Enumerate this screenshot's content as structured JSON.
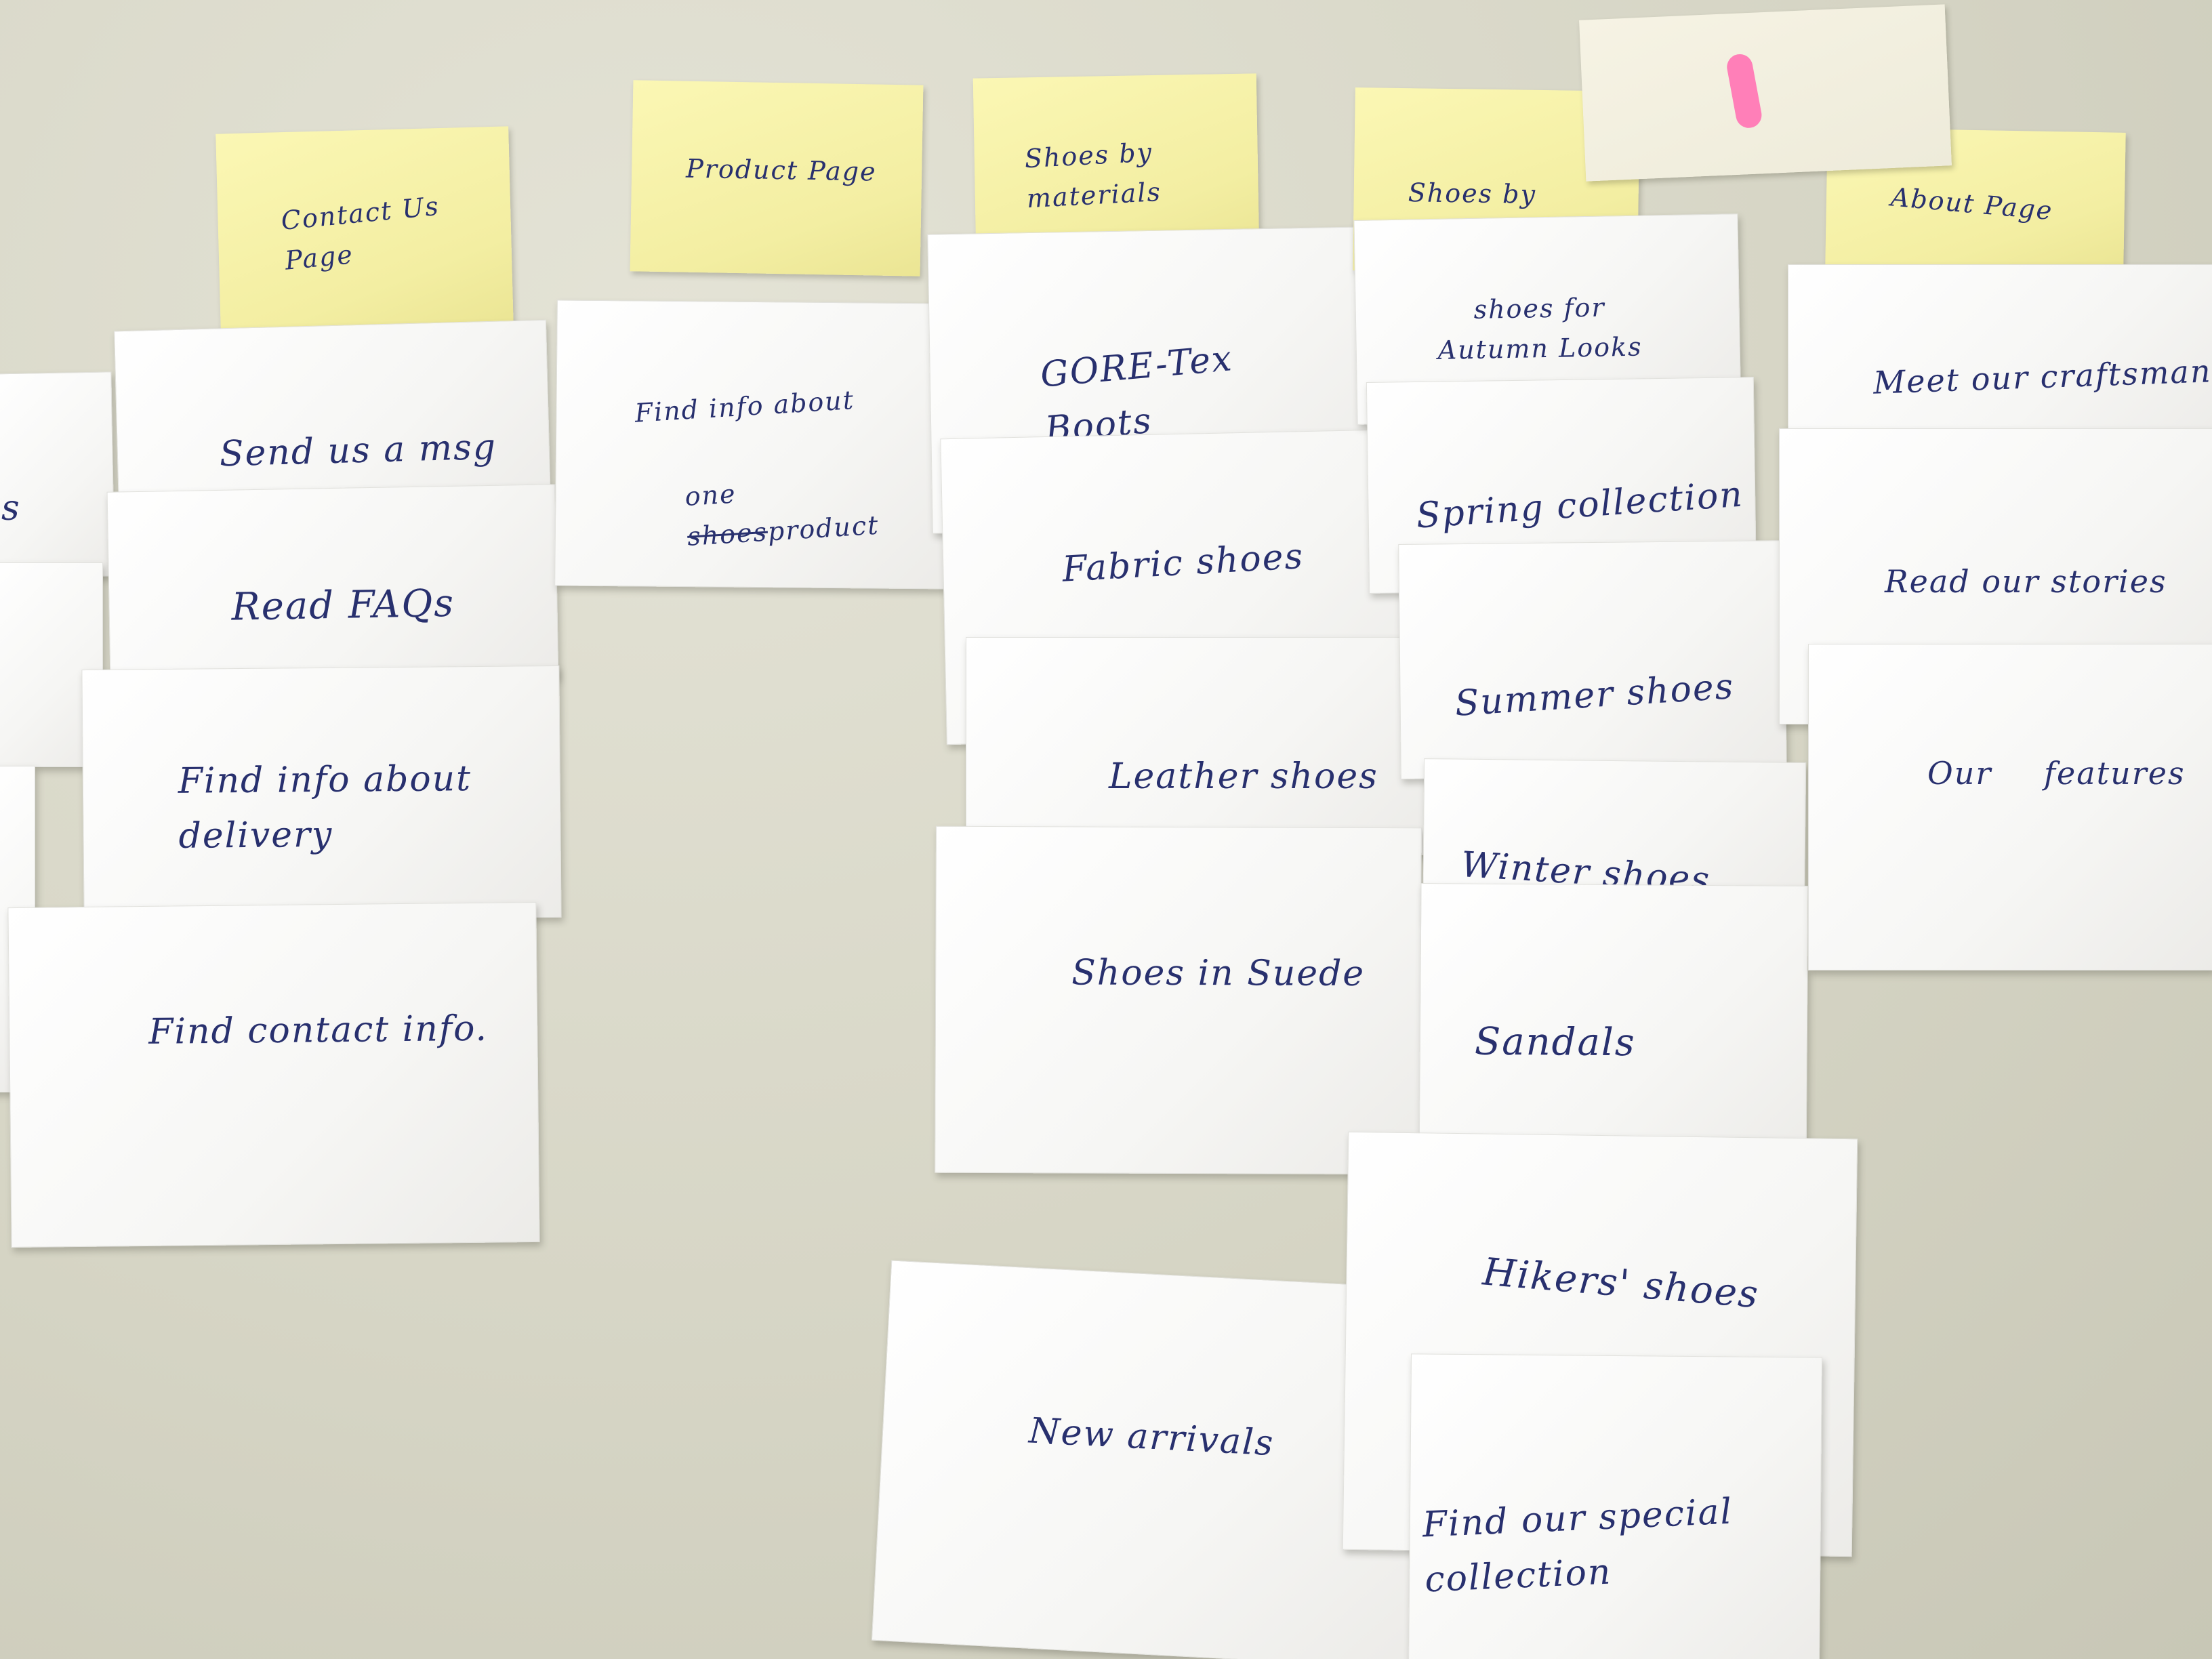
{
  "headers": {
    "contact": "Contact Us Page",
    "product": "Product Page",
    "materials": "Shoes by materials",
    "collections": "Shoes by collecti",
    "about": "About Page"
  },
  "contact_cards": {
    "c1": "Send us a msg",
    "c2": "Read FAQs",
    "c3": "Find info about\ndelivery",
    "c4": "Find contact info."
  },
  "product_cards": {
    "p1_line1": "Find info about",
    "p1_line2": "one",
    "p1_struck": "shoes",
    "p1_line2b": "product"
  },
  "materials_cards": {
    "m1": "GORE-Tex\nBoots",
    "m2": "Fabric shoes",
    "m3": "Leather shoes",
    "m4": "Shoes in Suede"
  },
  "collections_cards": {
    "k1": "shoes for\nAutumn Looks",
    "k2": "Spring collection",
    "k3": "Summer shoes",
    "k4": "Winter shoes",
    "k5": "Sandals",
    "k6": "Hikers' shoes",
    "k7": "Find our special\ncollection"
  },
  "loose_cards": {
    "n1": "New arrivals"
  },
  "about_cards": {
    "a1": "Meet our craftsman",
    "a2": "Read our stories",
    "a3": "Our features"
  },
  "left_edge": {
    "fragment": "s"
  },
  "colors": {
    "ink": "#28306e",
    "sticky_yellow": "#f6f1a8",
    "paper": "#ffffff",
    "table": "#dcdccd",
    "marker_pink": "#ff7fb8"
  }
}
